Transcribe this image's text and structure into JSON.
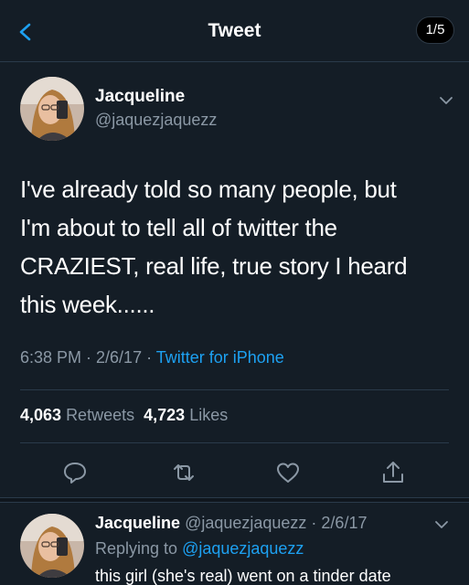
{
  "header": {
    "title": "Tweet",
    "counter": "1/5",
    "back_icon": "chevron-left-icon",
    "accent_color": "#1da1f2"
  },
  "tweet": {
    "author_name": "Jacqueline",
    "author_handle": "@jaquezjaquezz",
    "text_lines": [
      "I've already told so many people, but",
      "I'm about to tell all of twitter the",
      "CRAZIEST, real life, true story I heard",
      "this week......"
    ],
    "time": "6:38 PM · 2/6/17 · ",
    "source": "Twitter for iPhone",
    "retweet_count": "4,063",
    "retweet_label": "Retweets",
    "like_count": "4,723",
    "like_label": "Likes",
    "actions": [
      "reply-icon",
      "retweet-icon",
      "like-icon",
      "share-icon"
    ]
  },
  "reply": {
    "author_name": "Jacqueline",
    "meta": "@jaquezjaquezz · 2/6/17",
    "replying_prefix": "Replying to",
    "replying_to": "@jaquezjaquezz",
    "text": "this girl (she's real) went on a tinder date"
  },
  "colors": {
    "background": "#141d26",
    "secondary_text": "#8b98a5",
    "link": "#1da1f2"
  }
}
